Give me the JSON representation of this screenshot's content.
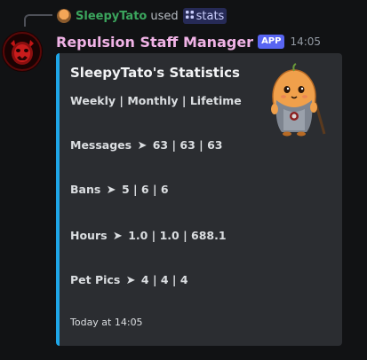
{
  "reply": {
    "avatar_icon": "potato-avatar-icon",
    "username": "SleepyTato",
    "used_text": "used",
    "command_icon": "slash-command-icon",
    "command": "stats"
  },
  "message": {
    "author": "Repulsion Staff Manager",
    "app_tag": "APP",
    "timestamp": "14:05",
    "avatar_icon": "red-demon-avatar-icon"
  },
  "embed": {
    "accent_color": "#1ea6e8",
    "title": "SleepyTato's Statistics",
    "subtitle": "Weekly | Monthly | Lifetime",
    "thumbnail_icon": "potato-character-icon",
    "stats": [
      {
        "label": "Messages",
        "arrow": "➤",
        "values": "63 | 63 | 63"
      },
      {
        "label": "Bans",
        "arrow": "➤",
        "values": "5 | 6 | 6"
      },
      {
        "label": "Hours",
        "arrow": "➤",
        "values": "1.0 | 1.0 | 688.1"
      },
      {
        "label": "Pet Pics",
        "arrow": "➤",
        "values": "4 | 4 | 4"
      }
    ],
    "footer": "Today at 14:05"
  }
}
